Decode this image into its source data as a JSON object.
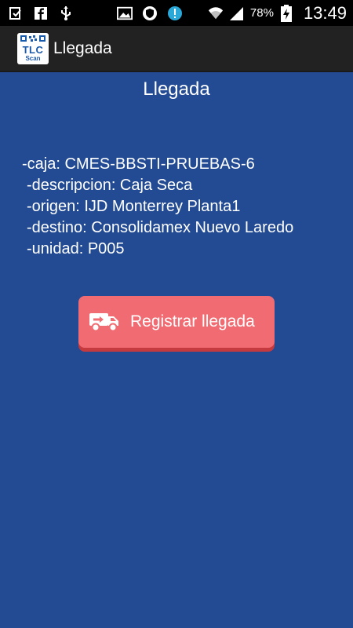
{
  "status_bar": {
    "icons": [
      "download-done-icon",
      "facebook-icon",
      "usb-icon",
      "image-icon",
      "shield-icon",
      "alert-icon",
      "wifi-icon",
      "signal-icon",
      "battery-charging-icon"
    ],
    "battery": "78%",
    "time": "13:49"
  },
  "action_bar": {
    "logo_text": "TLC",
    "logo_subtext": "Scan",
    "title": "Llegada"
  },
  "main": {
    "heading": "Llegada",
    "details": {
      "caja": "-caja: CMES-BBSTI-PRUEBAS-6",
      "descripcion": "-descripcion: Caja Seca",
      "origen": "-origen: IJD Monterrey Planta1",
      "destino": "-destino: Consolidamex Nuevo Laredo",
      "unidad": "-unidad: P005"
    },
    "register_button": {
      "label": "Registrar llegada",
      "icon": "truck-icon"
    }
  },
  "colors": {
    "background": "#234b93",
    "action_bar": "#222222",
    "button": "#f06c72",
    "button_shadow": "#c53a3f",
    "logo_blue": "#1b5aa8"
  }
}
